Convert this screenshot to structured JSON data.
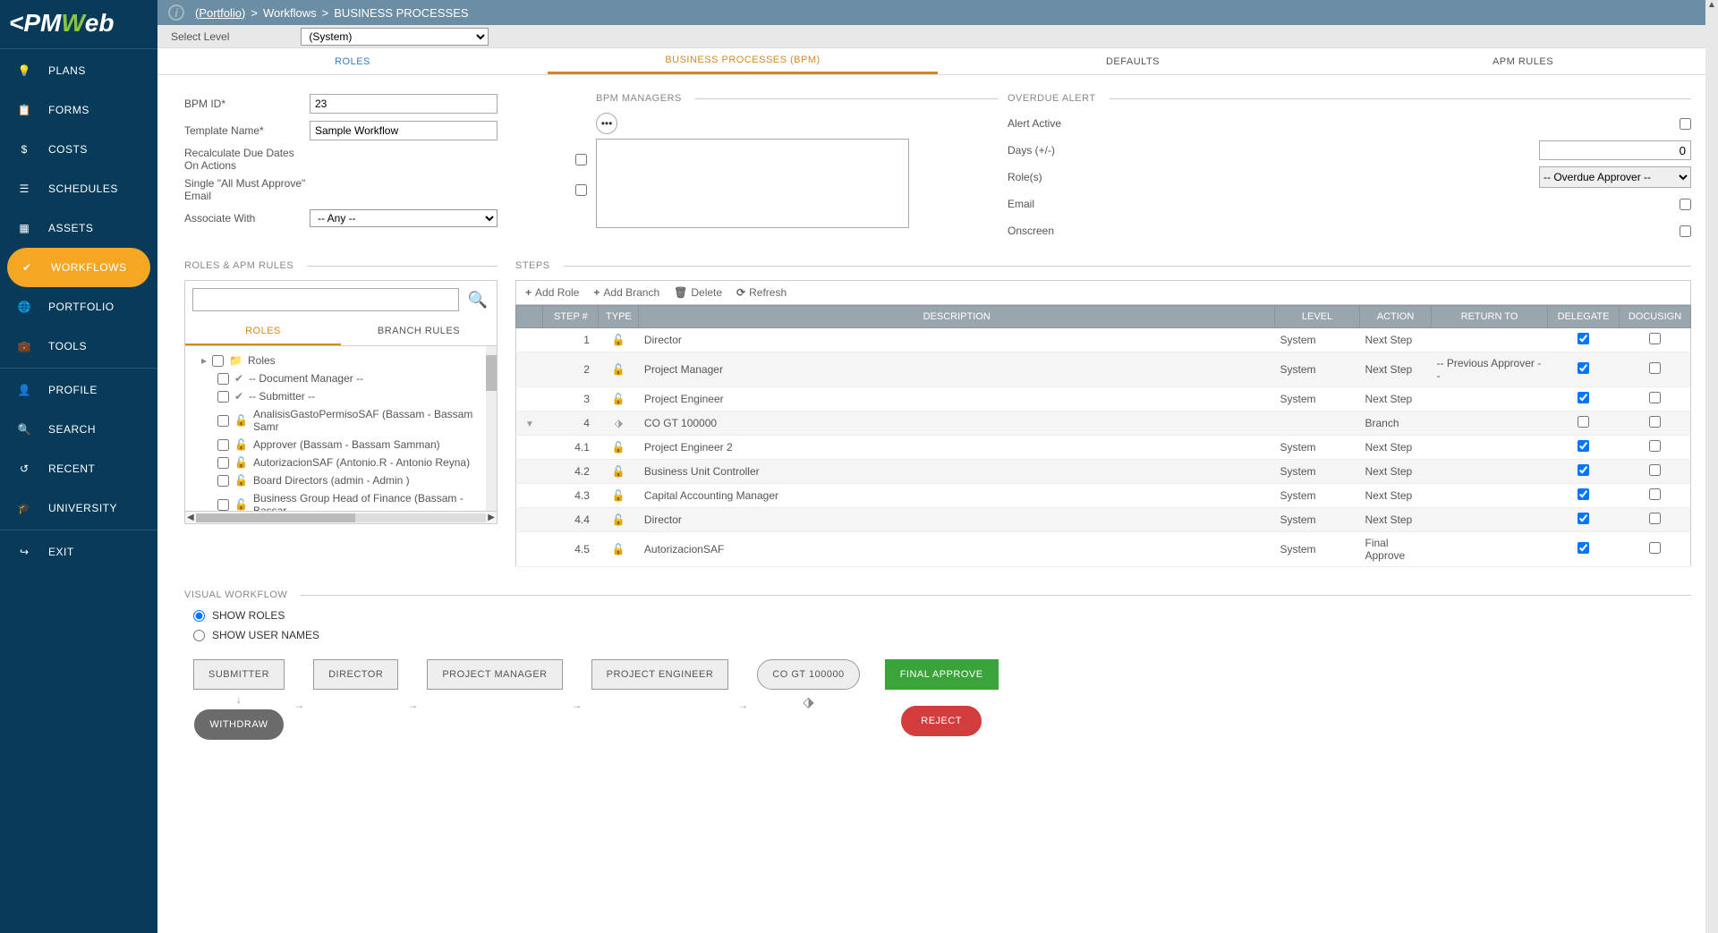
{
  "logo": {
    "prefix": "<PM",
    "w": "W",
    "suffix": "eb",
    "mark": "®"
  },
  "breadcrumb": {
    "portfolio": "(Portfolio)",
    "workflows": "Workflows",
    "bp": "BUSINESS PROCESSES"
  },
  "levelbar": {
    "label": "Select Level",
    "value": "(System)"
  },
  "tabs": {
    "roles": "ROLES",
    "bpm": "BUSINESS PROCESSES (BPM)",
    "defaults": "DEFAULTS",
    "apm": "APM RULES"
  },
  "sidebar": {
    "plans": "PLANS",
    "forms": "FORMS",
    "costs": "COSTS",
    "schedules": "SCHEDULES",
    "assets": "ASSETS",
    "workflows": "WORKFLOWS",
    "portfolio": "PORTFOLIO",
    "tools": "TOOLS",
    "profile": "PROFILE",
    "search": "SEARCH",
    "recent": "RECENT",
    "university": "UNIVERSITY",
    "exit": "EXIT"
  },
  "form": {
    "bpm_id_label": "BPM ID*",
    "bpm_id": "23",
    "template_label": "Template Name*",
    "template": "Sample Workflow",
    "recalc_label": "Recalculate Due Dates On Actions",
    "single_label": "Single \"All Must Approve\" Email",
    "assoc_label": "Associate With",
    "assoc_value": "-- Any --"
  },
  "managers": {
    "title": "BPM MANAGERS"
  },
  "overdue": {
    "title": "OVERDUE ALERT",
    "active_label": "Alert Active",
    "days_label": "Days (+/-)",
    "days_value": "0",
    "roles_label": "Role(s)",
    "roles_value": "-- Overdue Approver --",
    "email_label": "Email",
    "onscreen_label": "Onscreen"
  },
  "rolespanel": {
    "title": "ROLES & APM RULES",
    "subtab_roles": "ROLES",
    "subtab_branch": "BRANCH RULES",
    "root": "Roles",
    "items": [
      "-- Document Manager --",
      "-- Submitter --",
      "AnalisisGastoPermisoSAF (Bassam - Bassam Samr",
      "Approver (Bassam - Bassam Samman)",
      "AutorizacionSAF (Antonio.R - Antonio Reyna)",
      "Board Directors (admin - Admin )",
      "Business Group Head of Finance (Bassam - Bassar"
    ]
  },
  "steps": {
    "title": "STEPS",
    "toolbar": {
      "add_role": "Add Role",
      "add_branch": "Add Branch",
      "delete": "Delete",
      "refresh": "Refresh"
    },
    "headers": {
      "step": "STEP #",
      "type": "TYPE",
      "desc": "DESCRIPTION",
      "level": "LEVEL",
      "action": "ACTION",
      "return": "RETURN TO",
      "delegate": "DELEGATE",
      "docusign": "DOCUSIGN"
    },
    "rows": [
      {
        "num": "1",
        "type": "lock",
        "desc": "Director",
        "level": "System",
        "action": "Next Step",
        "return": "",
        "delegate": true,
        "docusign": false
      },
      {
        "num": "2",
        "type": "lock",
        "desc": "Project Manager",
        "level": "System",
        "action": "Next Step",
        "return": "-- Previous Approver --",
        "delegate": true,
        "docusign": false
      },
      {
        "num": "3",
        "type": "lock",
        "desc": "Project Engineer",
        "level": "System",
        "action": "Next Step",
        "return": "",
        "delegate": true,
        "docusign": false
      },
      {
        "num": "4",
        "type": "branch",
        "desc": "CO GT 100000",
        "level": "",
        "action": "Branch",
        "return": "",
        "delegate": false,
        "docusign": false,
        "expand": true
      },
      {
        "num": "4.1",
        "type": "lock",
        "desc": "Project Engineer 2",
        "level": "System",
        "action": "Next Step",
        "return": "",
        "delegate": true,
        "docusign": false,
        "sub": true
      },
      {
        "num": "4.2",
        "type": "lock",
        "desc": "Business Unit Controller",
        "level": "System",
        "action": "Next Step",
        "return": "",
        "delegate": true,
        "docusign": false,
        "sub": true
      },
      {
        "num": "4.3",
        "type": "lock",
        "desc": "Capital Accounting Manager",
        "level": "System",
        "action": "Next Step",
        "return": "",
        "delegate": true,
        "docusign": false,
        "sub": true
      },
      {
        "num": "4.4",
        "type": "lock",
        "desc": "Director",
        "level": "System",
        "action": "Next Step",
        "return": "",
        "delegate": true,
        "docusign": false,
        "sub": true
      },
      {
        "num": "4.5",
        "type": "lock",
        "desc": "AutorizacionSAF",
        "level": "System",
        "action": "Final Approve",
        "return": "",
        "delegate": true,
        "docusign": false,
        "sub": true
      }
    ]
  },
  "visual": {
    "title": "VISUAL WORKFLOW",
    "show_roles": "SHOW ROLES",
    "show_users": "SHOW USER NAMES",
    "boxes": {
      "submitter": "SUBMITTER",
      "director": "DIRECTOR",
      "pm": "PROJECT MANAGER",
      "pe": "PROJECT ENGINEER",
      "co": "CO GT 100000",
      "final": "FINAL APPROVE",
      "withdraw": "WITHDRAW",
      "reject": "REJECT"
    }
  }
}
